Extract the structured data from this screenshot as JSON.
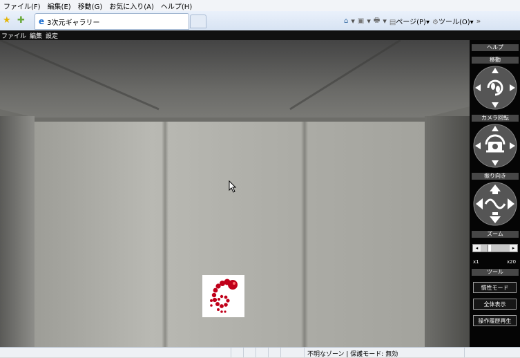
{
  "browser": {
    "menu": [
      "ファイル(F)",
      "編集(E)",
      "移動(G)",
      "お気に入り(A)",
      "ヘルプ(H)"
    ],
    "tab_title": "3次元ギャラリー",
    "commands": {
      "home_icon": "home-icon",
      "feeds_icon": "feeds-icon",
      "print_icon": "print-icon",
      "page_label": "ページ(P)",
      "tools_label": "ツール(O)"
    }
  },
  "app_menu": [
    "ファイル",
    "編集",
    "設定"
  ],
  "panel": {
    "help": "ヘルプ",
    "move": "移動",
    "camera_rotate": "カメラ回転",
    "orientation": "振り向き",
    "zoom": "ズーム",
    "zoom_min": "x1",
    "zoom_max": "x20",
    "zoom_level": 0.25,
    "tools": "ツール",
    "buttons": [
      "慣性モード",
      "全体表示",
      "操作履歴再生"
    ]
  },
  "status": {
    "text": "不明なゾーン | 保護モード: 無効"
  },
  "colors": {
    "panel_bg": "#050505",
    "header_bg": "#474747",
    "logo_red": "#c0001a"
  }
}
